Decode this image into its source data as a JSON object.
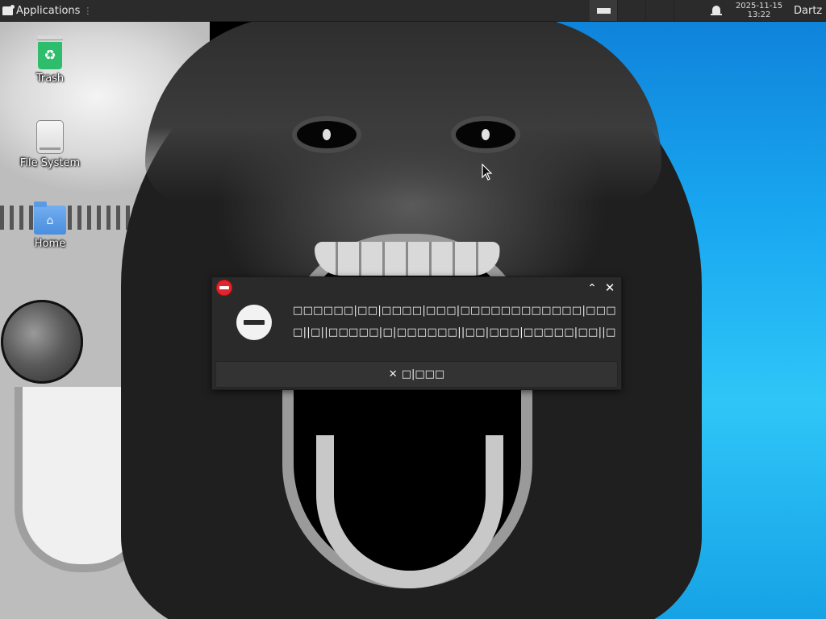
{
  "top_panel": {
    "applications_label": "Applications",
    "applications_separator": "⋮",
    "clock_date": "2025-11-15",
    "clock_time": "13:22",
    "user_name": "Dartz"
  },
  "desktop_icons": [
    {
      "label": "Trash",
      "icon": "trash-icon"
    },
    {
      "label": "File System",
      "icon": "drive-icon"
    },
    {
      "label": "Home",
      "icon": "home-folder-icon"
    }
  ],
  "dialog": {
    "title_icon": "error-icon",
    "body_icon": "error-circle-icon",
    "message_line_1": "□□□□□□|□□|□□□□|□□□|□□□□□□□□□□□□|□□□□",
    "message_line_2": "□||□||□□□□□|□|□□□□□□||□□|□□□|□□□□□|□□||□□□□",
    "close_button_icon": "✕",
    "close_button_label": "□|□□□",
    "maximize_glyph": "⌃",
    "close_glyph": "✕"
  },
  "colors": {
    "panel_bg": "#2b2b2b",
    "dialog_bg": "#2a2a2a",
    "error_red": "#e5252c",
    "trash_green": "#2ebd6b",
    "home_blue": "#5b9be6"
  }
}
